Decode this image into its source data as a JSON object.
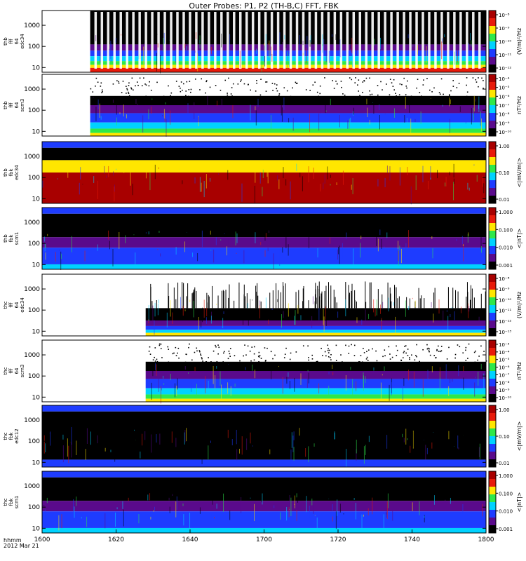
{
  "title": "Outer Probes: P1, P2 (TH-B,C) FFT, FBK",
  "x_axis": {
    "corner_label_1": "hhmm",
    "corner_label_2": "2012 Mar 21",
    "ticks": [
      "1600",
      "1620",
      "1640",
      "1700",
      "1720",
      "1740",
      "1800"
    ]
  },
  "chart_data": [
    {
      "type": "heatmap",
      "ylabel": [
        "thb",
        "fff",
        "64",
        "edc34"
      ],
      "y_ticks": [
        "10",
        "100",
        "1000"
      ],
      "y_scale": "log",
      "colorbar": {
        "label": "(V/m)²/Hz",
        "ticks": [
          "10⁻⁸",
          "10⁻⁹",
          "10⁻¹⁰",
          "10⁻¹¹",
          "10⁻¹²"
        ]
      },
      "data_start": "1613",
      "pattern": "periodic"
    },
    {
      "type": "heatmap",
      "ylabel": [
        "thb",
        "fff",
        "64",
        "scm3"
      ],
      "y_ticks": [
        "10",
        "100",
        "1000"
      ],
      "y_scale": "log",
      "colorbar": {
        "label": "nT²/Hz",
        "ticks": [
          "10⁻⁴",
          "10⁻⁵",
          "10⁻⁶",
          "10⁻⁷",
          "10⁻⁸",
          "10⁻⁹",
          "10⁻¹⁰"
        ]
      },
      "data_start": "1613",
      "pattern": "bands"
    },
    {
      "type": "heatmap",
      "ylabel": [
        "thb",
        "fbk",
        "edc34"
      ],
      "y_ticks": [
        "10",
        "100",
        "1000"
      ],
      "y_scale": "log",
      "colorbar": {
        "label": "<|mV/m|>",
        "ticks": [
          "1.00",
          "0.10",
          "0.01"
        ]
      },
      "data_start": "1600",
      "pattern": "fbk_e"
    },
    {
      "type": "heatmap",
      "ylabel": [
        "thb",
        "fbk",
        "scm1"
      ],
      "y_ticks": [
        "10",
        "100",
        "1000"
      ],
      "y_scale": "log",
      "colorbar": {
        "label": "<|nT|>",
        "ticks": [
          "1.000",
          "0.100",
          "0.010",
          "0.001"
        ]
      },
      "data_start": "1600",
      "pattern": "fbk_b"
    },
    {
      "type": "heatmap",
      "ylabel": [
        "thc",
        "fff",
        "64",
        "edc34"
      ],
      "y_ticks": [
        "10",
        "100",
        "1000"
      ],
      "y_scale": "log",
      "colorbar": {
        "label": "(V/m)²/Hz",
        "ticks": [
          "10⁻⁸",
          "10⁻⁹",
          "10⁻¹⁰",
          "10⁻¹¹",
          "10⁻¹²",
          "10⁻¹³"
        ]
      },
      "data_start": "1628",
      "pattern": "sparse"
    },
    {
      "type": "heatmap",
      "ylabel": [
        "thc",
        "fff",
        "64",
        "scm3"
      ],
      "y_ticks": [
        "10",
        "100",
        "1000"
      ],
      "y_scale": "log",
      "colorbar": {
        "label": "nT²/Hz",
        "ticks": [
          "10⁻³",
          "10⁻⁴",
          "10⁻⁵",
          "10⁻⁶",
          "10⁻⁷",
          "10⁻⁸",
          "10⁻⁹",
          "10⁻¹⁰"
        ]
      },
      "data_start": "1628",
      "pattern": "bands"
    },
    {
      "type": "heatmap",
      "ylabel": [
        "thc",
        "fbk",
        "edc12"
      ],
      "y_ticks": [
        "10",
        "100",
        "1000"
      ],
      "y_scale": "log",
      "colorbar": {
        "label": "<|mV/m|>",
        "ticks": [
          "1.00",
          "0.10",
          "0.01"
        ]
      },
      "data_start": "1600",
      "pattern": "fbk_dark"
    },
    {
      "type": "heatmap",
      "ylabel": [
        "thc",
        "fbk",
        "scm1"
      ],
      "y_ticks": [
        "10",
        "100",
        "1000"
      ],
      "y_scale": "log",
      "colorbar": {
        "label": "<|nT|>",
        "ticks": [
          "1.000",
          "0.100",
          "0.010",
          "0.001"
        ]
      },
      "data_start": "1600",
      "pattern": "fbk_b"
    }
  ],
  "colors": {
    "black": "#000000",
    "purple": "#5a0a8c",
    "blue": "#1e3cff",
    "cyan": "#00d2ff",
    "green": "#2ee84a",
    "yellow": "#ffe600",
    "red": "#e81a0a",
    "darkred": "#a80000"
  }
}
